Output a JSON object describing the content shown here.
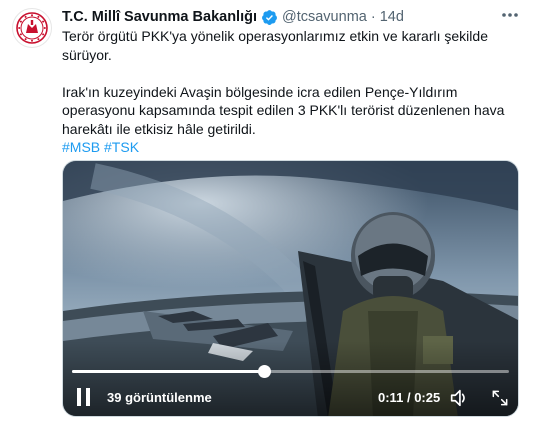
{
  "tweet": {
    "display_name": "T.C. Millî Savunma Bakanlığı",
    "handle": "@tcsavunma",
    "separator": "·",
    "time": "14d",
    "body_line1": "Terör örgütü PKK'ya yönelik operasyonlarımız etkin ve kararlı şekilde sürüyor.",
    "body_line2": "Irak'ın kuzeyindeki Avaşin bölgesinde icra edilen Pençe-Yıldırım operasyonu kapsamında tespit edilen 3 PKK'lı terörist düzenlenen hava harekâtı ile etkisiz hâle getirildi.",
    "hashtags": [
      "#MSB",
      "#TSK"
    ]
  },
  "video": {
    "views": "39 görüntülenme",
    "elapsed": "0:11",
    "duration": "0:25",
    "timer_separator": "/",
    "progress_fraction": 0.44
  },
  "icons": {
    "avatar": "ministry-emblem",
    "verified": "verified-badge-icon",
    "more": "more-options-icon",
    "play": "pause-icon",
    "volume": "volume-icon",
    "fullscreen": "fullscreen-icon"
  },
  "colors": {
    "accent": "#1d9bf0",
    "emblem_red": "#c8102e",
    "text": "#0f1419",
    "muted": "#536471"
  }
}
